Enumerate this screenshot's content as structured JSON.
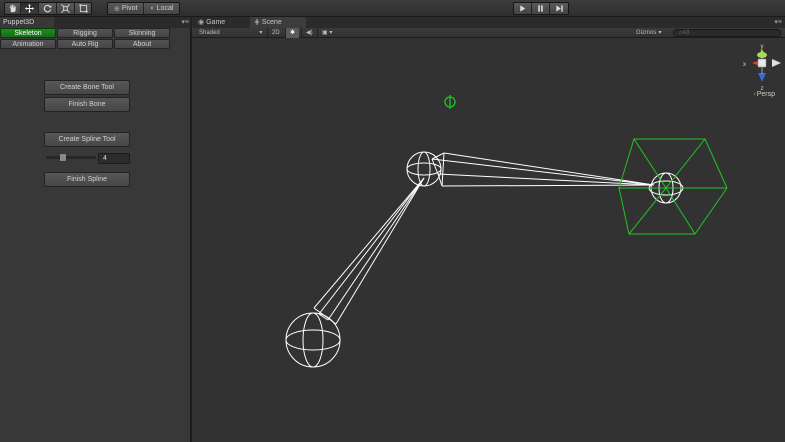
{
  "toolbar": {
    "pivot_label": "Pivot",
    "local_label": "Local",
    "tools": [
      "hand-tool",
      "move-tool",
      "rotate-tool",
      "scale-tool",
      "rect-tool"
    ]
  },
  "panel": {
    "title": "Puppet3D",
    "tabs_row1": [
      "Skeleton",
      "Rigging",
      "Skinning"
    ],
    "tabs_row2": [
      "Animation",
      "Auto Rig",
      "About"
    ],
    "selected_tab": "Skeleton",
    "buttons": {
      "create_bone": "Create Bone Tool",
      "finish_bone": "Finish Bone",
      "create_spline": "Create Spline Tool",
      "finish_spline": "Finish Spline"
    },
    "spline_count": "4"
  },
  "scene": {
    "tab_game": "Game",
    "tab_scene": "Scene",
    "shading_mode": "Shaded",
    "mode_2d": "2D",
    "gizmos_label": "Gizmos",
    "search_placeholder": "All",
    "persp_label": "Persp",
    "axis_y": "y",
    "axis_x": "x",
    "axis_z": "z"
  },
  "colors": {
    "selected_tab": "#1f8a1f",
    "bone_wire": "#ffffff",
    "control_wire": "#22c422",
    "viewport_bg": "#323232",
    "axis_y": "#a5e04a",
    "axis_x": "#e0402c",
    "axis_z": "#3c66e0"
  }
}
